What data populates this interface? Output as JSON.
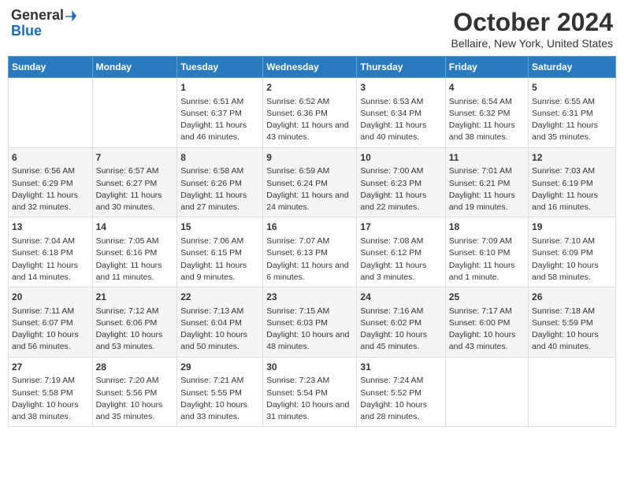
{
  "logo": {
    "general": "General",
    "blue": "Blue"
  },
  "title": "October 2024",
  "subtitle": "Bellaire, New York, United States",
  "days_of_week": [
    "Sunday",
    "Monday",
    "Tuesday",
    "Wednesday",
    "Thursday",
    "Friday",
    "Saturday"
  ],
  "weeks": [
    [
      {
        "day": "",
        "sunrise": "",
        "sunset": "",
        "daylight": ""
      },
      {
        "day": "",
        "sunrise": "",
        "sunset": "",
        "daylight": ""
      },
      {
        "day": "1",
        "sunrise": "Sunrise: 6:51 AM",
        "sunset": "Sunset: 6:37 PM",
        "daylight": "Daylight: 11 hours and 46 minutes."
      },
      {
        "day": "2",
        "sunrise": "Sunrise: 6:52 AM",
        "sunset": "Sunset: 6:36 PM",
        "daylight": "Daylight: 11 hours and 43 minutes."
      },
      {
        "day": "3",
        "sunrise": "Sunrise: 6:53 AM",
        "sunset": "Sunset: 6:34 PM",
        "daylight": "Daylight: 11 hours and 40 minutes."
      },
      {
        "day": "4",
        "sunrise": "Sunrise: 6:54 AM",
        "sunset": "Sunset: 6:32 PM",
        "daylight": "Daylight: 11 hours and 38 minutes."
      },
      {
        "day": "5",
        "sunrise": "Sunrise: 6:55 AM",
        "sunset": "Sunset: 6:31 PM",
        "daylight": "Daylight: 11 hours and 35 minutes."
      }
    ],
    [
      {
        "day": "6",
        "sunrise": "Sunrise: 6:56 AM",
        "sunset": "Sunset: 6:29 PM",
        "daylight": "Daylight: 11 hours and 32 minutes."
      },
      {
        "day": "7",
        "sunrise": "Sunrise: 6:57 AM",
        "sunset": "Sunset: 6:27 PM",
        "daylight": "Daylight: 11 hours and 30 minutes."
      },
      {
        "day": "8",
        "sunrise": "Sunrise: 6:58 AM",
        "sunset": "Sunset: 6:26 PM",
        "daylight": "Daylight: 11 hours and 27 minutes."
      },
      {
        "day": "9",
        "sunrise": "Sunrise: 6:59 AM",
        "sunset": "Sunset: 6:24 PM",
        "daylight": "Daylight: 11 hours and 24 minutes."
      },
      {
        "day": "10",
        "sunrise": "Sunrise: 7:00 AM",
        "sunset": "Sunset: 6:23 PM",
        "daylight": "Daylight: 11 hours and 22 minutes."
      },
      {
        "day": "11",
        "sunrise": "Sunrise: 7:01 AM",
        "sunset": "Sunset: 6:21 PM",
        "daylight": "Daylight: 11 hours and 19 minutes."
      },
      {
        "day": "12",
        "sunrise": "Sunrise: 7:03 AM",
        "sunset": "Sunset: 6:19 PM",
        "daylight": "Daylight: 11 hours and 16 minutes."
      }
    ],
    [
      {
        "day": "13",
        "sunrise": "Sunrise: 7:04 AM",
        "sunset": "Sunset: 6:18 PM",
        "daylight": "Daylight: 11 hours and 14 minutes."
      },
      {
        "day": "14",
        "sunrise": "Sunrise: 7:05 AM",
        "sunset": "Sunset: 6:16 PM",
        "daylight": "Daylight: 11 hours and 11 minutes."
      },
      {
        "day": "15",
        "sunrise": "Sunrise: 7:06 AM",
        "sunset": "Sunset: 6:15 PM",
        "daylight": "Daylight: 11 hours and 9 minutes."
      },
      {
        "day": "16",
        "sunrise": "Sunrise: 7:07 AM",
        "sunset": "Sunset: 6:13 PM",
        "daylight": "Daylight: 11 hours and 6 minutes."
      },
      {
        "day": "17",
        "sunrise": "Sunrise: 7:08 AM",
        "sunset": "Sunset: 6:12 PM",
        "daylight": "Daylight: 11 hours and 3 minutes."
      },
      {
        "day": "18",
        "sunrise": "Sunrise: 7:09 AM",
        "sunset": "Sunset: 6:10 PM",
        "daylight": "Daylight: 11 hours and 1 minute."
      },
      {
        "day": "19",
        "sunrise": "Sunrise: 7:10 AM",
        "sunset": "Sunset: 6:09 PM",
        "daylight": "Daylight: 10 hours and 58 minutes."
      }
    ],
    [
      {
        "day": "20",
        "sunrise": "Sunrise: 7:11 AM",
        "sunset": "Sunset: 6:07 PM",
        "daylight": "Daylight: 10 hours and 56 minutes."
      },
      {
        "day": "21",
        "sunrise": "Sunrise: 7:12 AM",
        "sunset": "Sunset: 6:06 PM",
        "daylight": "Daylight: 10 hours and 53 minutes."
      },
      {
        "day": "22",
        "sunrise": "Sunrise: 7:13 AM",
        "sunset": "Sunset: 6:04 PM",
        "daylight": "Daylight: 10 hours and 50 minutes."
      },
      {
        "day": "23",
        "sunrise": "Sunrise: 7:15 AM",
        "sunset": "Sunset: 6:03 PM",
        "daylight": "Daylight: 10 hours and 48 minutes."
      },
      {
        "day": "24",
        "sunrise": "Sunrise: 7:16 AM",
        "sunset": "Sunset: 6:02 PM",
        "daylight": "Daylight: 10 hours and 45 minutes."
      },
      {
        "day": "25",
        "sunrise": "Sunrise: 7:17 AM",
        "sunset": "Sunset: 6:00 PM",
        "daylight": "Daylight: 10 hours and 43 minutes."
      },
      {
        "day": "26",
        "sunrise": "Sunrise: 7:18 AM",
        "sunset": "Sunset: 5:59 PM",
        "daylight": "Daylight: 10 hours and 40 minutes."
      }
    ],
    [
      {
        "day": "27",
        "sunrise": "Sunrise: 7:19 AM",
        "sunset": "Sunset: 5:58 PM",
        "daylight": "Daylight: 10 hours and 38 minutes."
      },
      {
        "day": "28",
        "sunrise": "Sunrise: 7:20 AM",
        "sunset": "Sunset: 5:56 PM",
        "daylight": "Daylight: 10 hours and 35 minutes."
      },
      {
        "day": "29",
        "sunrise": "Sunrise: 7:21 AM",
        "sunset": "Sunset: 5:55 PM",
        "daylight": "Daylight: 10 hours and 33 minutes."
      },
      {
        "day": "30",
        "sunrise": "Sunrise: 7:23 AM",
        "sunset": "Sunset: 5:54 PM",
        "daylight": "Daylight: 10 hours and 31 minutes."
      },
      {
        "day": "31",
        "sunrise": "Sunrise: 7:24 AM",
        "sunset": "Sunset: 5:52 PM",
        "daylight": "Daylight: 10 hours and 28 minutes."
      },
      {
        "day": "",
        "sunrise": "",
        "sunset": "",
        "daylight": ""
      },
      {
        "day": "",
        "sunrise": "",
        "sunset": "",
        "daylight": ""
      }
    ]
  ]
}
